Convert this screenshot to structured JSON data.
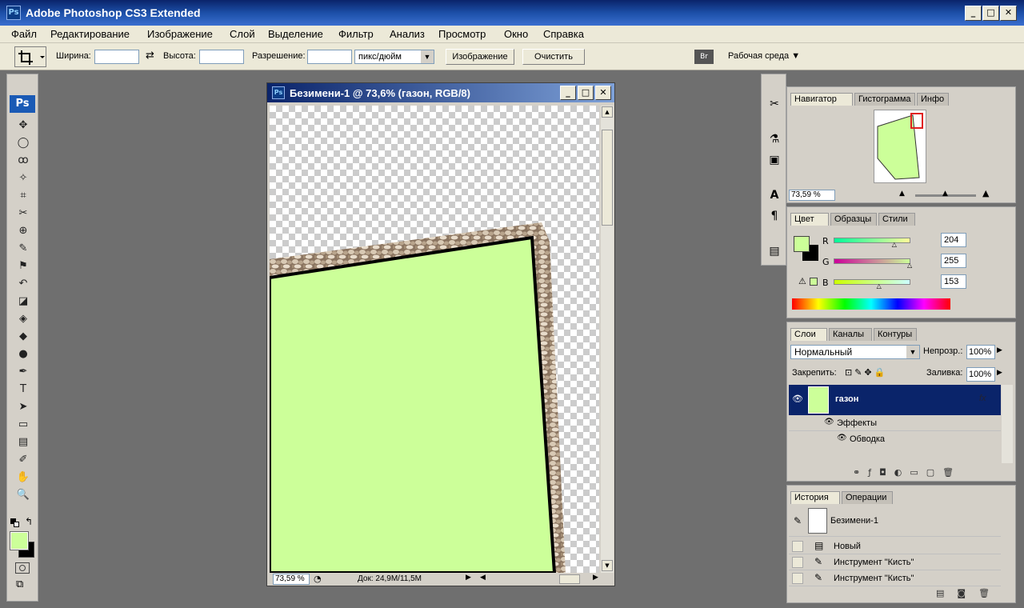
{
  "window": {
    "title": "Adobe Photoshop CS3 Extended",
    "app_icon": "Ps",
    "controls": [
      "_",
      "□",
      "✕"
    ]
  },
  "menu": [
    "Файл",
    "Редактирование",
    "Изображение",
    "Слой",
    "Выделение",
    "Фильтр",
    "Анализ",
    "Просмотр",
    "Окно",
    "Справка"
  ],
  "options": {
    "width_label": "Ширина:",
    "width_value": "",
    "height_label": "Высота:",
    "height_value": "",
    "resolution_label": "Разрешение:",
    "resolution_value": "",
    "unit": "пикс/дюйм",
    "image_button": "Изображение",
    "clear_button": "Очистить",
    "workspace": "Рабочая среда ▼"
  },
  "toolbox": {
    "logo": "Ps",
    "tools": [
      "move-tool-icon",
      "marquee-tool-icon",
      "lasso-tool-icon",
      "magic-wand-icon",
      "crop-tool-icon",
      "slice-tool-icon",
      "healing-brush-icon",
      "brush-tool-icon",
      "clone-stamp-icon",
      "history-brush-icon",
      "eraser-tool-icon",
      "paint-bucket-icon",
      "blur-tool-icon",
      "dodge-tool-icon",
      "pen-tool-icon",
      "type-tool-icon",
      "path-selection-icon",
      "shape-tool-icon",
      "notes-tool-icon",
      "eyedropper-icon",
      "hand-tool-icon",
      "zoom-tool-icon"
    ],
    "glyphs": [
      "✥",
      "◯",
      "ꝏ",
      "✧",
      "⌗",
      "✂",
      "⊕",
      "✎",
      "⚑",
      "↶",
      "◪",
      "◈",
      "◆",
      "●",
      "✒",
      "T",
      "➤",
      "▭",
      "▤",
      "✐",
      "✋",
      "🔍"
    ],
    "foreground": "#ccff99",
    "background": "#000000"
  },
  "document": {
    "title": "Безимени-1 @ 73,6% (газон, RGB/8)",
    "zoom": "73,59 %",
    "doc_info": "Док: 24,9M/11,5M",
    "fill_color": "#ccff99"
  },
  "navigator": {
    "tabs": [
      "Навигатор",
      "Гистограмма",
      "Инфо"
    ],
    "zoom": "73,59 %"
  },
  "color": {
    "tabs": [
      "Цвет",
      "Образцы",
      "Стили"
    ],
    "r_label": "R",
    "g_label": "G",
    "b_label": "B",
    "r": "204",
    "g": "255",
    "b": "153",
    "r_level": 0.8,
    "g_level": 1.0,
    "b_level": 0.6
  },
  "layers": {
    "tabs": [
      "Слои",
      "Каналы",
      "Контуры"
    ],
    "blend_mode": "Нормальный",
    "opacity_label": "Непрозр.:",
    "opacity": "100%",
    "lock_label": "Закрепить:",
    "fill_label": "Заливка:",
    "fill": "100%",
    "layer_name": "газон",
    "effects_label": "Эффекты",
    "stroke_label": "Обводка"
  },
  "history": {
    "tabs": [
      "История",
      "Операции"
    ],
    "snapshot": "Безимени-1",
    "items": [
      "Новый",
      "Инструмент \"Кисть\"",
      "Инструмент \"Кисть\""
    ]
  }
}
